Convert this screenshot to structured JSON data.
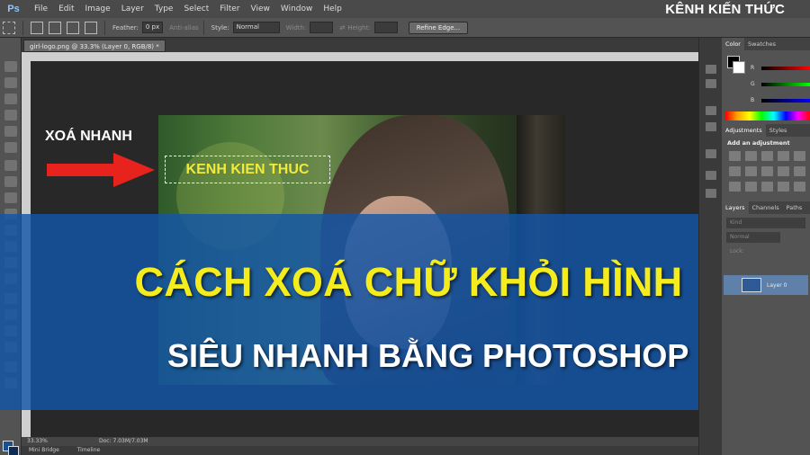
{
  "app": {
    "logo": "Ps"
  },
  "menu": [
    "File",
    "Edit",
    "Image",
    "Layer",
    "Type",
    "Select",
    "Filter",
    "View",
    "Window",
    "Help"
  ],
  "brand": "KÊNH KIẾN THỨC",
  "options": {
    "feather_label": "Feather:",
    "feather_value": "0 px",
    "anti_alias": "Anti-alias",
    "style_label": "Style:",
    "style_value": "Normal",
    "width_label": "Width:",
    "height_label": "Height:",
    "refine_edge": "Refine Edge..."
  },
  "document": {
    "tab_title": "girl-logo.png @ 33.3% (Layer 0, RGB/8) *"
  },
  "annotation": {
    "label": "XOÁ NHANH",
    "selected_text": "KENH KIEN THUC",
    "arrow_color": "#e8221c"
  },
  "banner": {
    "title_line1": "CÁCH XOÁ CHỮ KHỎI HÌNH",
    "title_line2": "SIÊU NHANH BẰNG PHOTOSHOP",
    "line1_color": "#f5ec1e",
    "background_color": "#1256a8"
  },
  "status": {
    "zoom": "33.33%",
    "doc": "Doc: 7.03M/7.03M"
  },
  "bottom_tabs": [
    "Mini Bridge",
    "Timeline"
  ],
  "panels": {
    "color_tabs": [
      "Color",
      "Swatches"
    ],
    "channels": [
      "R",
      "G",
      "B"
    ],
    "adjust_tabs": [
      "Adjustments",
      "Styles"
    ],
    "adjust_title": "Add an adjustment",
    "layer_tabs": [
      "Layers",
      "Channels",
      "Paths"
    ],
    "kind": "Kind",
    "blend_mode": "Normal",
    "lock_label": "Lock:",
    "layer_name": "Layer 0"
  }
}
